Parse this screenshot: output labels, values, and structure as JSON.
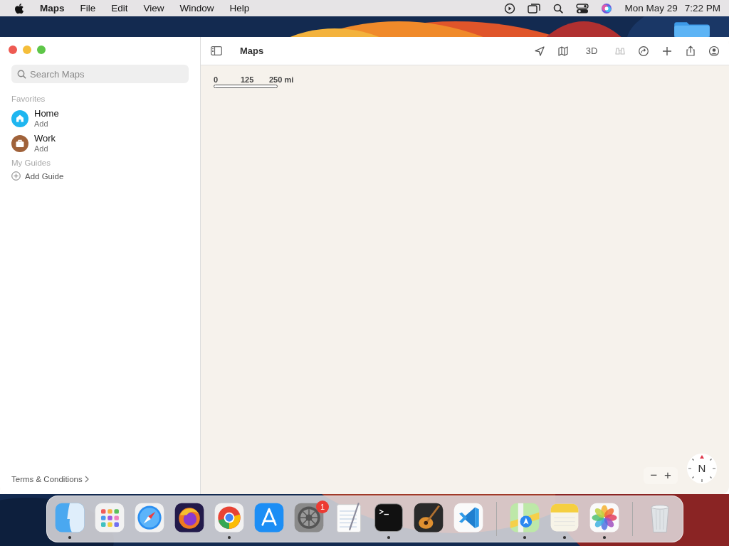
{
  "menu_bar": {
    "app_name": "Maps",
    "menus": [
      "File",
      "Edit",
      "View",
      "Window",
      "Help"
    ],
    "date": "Mon May 29",
    "time": "7:22 PM"
  },
  "window": {
    "title": "Maps",
    "toolbar": [
      {
        "kind": "location",
        "disabled": false
      },
      {
        "kind": "map",
        "disabled": false
      },
      {
        "kind": "text",
        "label": "3D",
        "disabled": false
      },
      {
        "kind": "binoculars",
        "disabled": true
      },
      {
        "kind": "route",
        "disabled": false
      },
      {
        "kind": "plus",
        "disabled": false
      },
      {
        "kind": "share",
        "disabled": false
      },
      {
        "kind": "account",
        "disabled": false
      }
    ],
    "sidebar": {
      "search": {
        "placeholder": "Search Maps"
      },
      "sections": [
        {
          "heading": "Favorites",
          "items": [
            {
              "kind": "favorite",
              "title": "Home",
              "subtitle": "Add",
              "color": "#1eb6f0"
            },
            {
              "kind": "favorite",
              "title": "Work",
              "subtitle": "Add",
              "color": "#a0623a"
            }
          ]
        },
        {
          "heading": "My Guides",
          "items": [
            {
              "kind": "action",
              "title": "Add Guide"
            }
          ]
        }
      ],
      "footer_link": "Terms & Conditions"
    },
    "map": {
      "scale": [
        "0",
        "125",
        "250 mi"
      ],
      "zoom_out": "−",
      "zoom_in": "+",
      "compass": "N"
    }
  },
  "dock": {
    "apps": [
      {
        "kind": "finder",
        "running": true
      },
      {
        "kind": "launchpad",
        "running": false
      },
      {
        "kind": "safari",
        "running": false
      },
      {
        "kind": "firefox",
        "running": false
      },
      {
        "kind": "chrome",
        "running": true
      },
      {
        "kind": "appstore",
        "running": false
      },
      {
        "kind": "settings",
        "running": false,
        "badge": "1"
      },
      {
        "kind": "textedit",
        "running": false
      },
      {
        "kind": "terminal",
        "running": true
      },
      {
        "kind": "guitar",
        "running": false
      },
      {
        "kind": "vscode",
        "running": false
      },
      {
        "kind": "separator"
      },
      {
        "kind": "maps",
        "running": true
      },
      {
        "kind": "notes",
        "running": true
      },
      {
        "kind": "photos",
        "running": true
      },
      {
        "kind": "separator"
      },
      {
        "kind": "trash",
        "running": false
      }
    ]
  }
}
